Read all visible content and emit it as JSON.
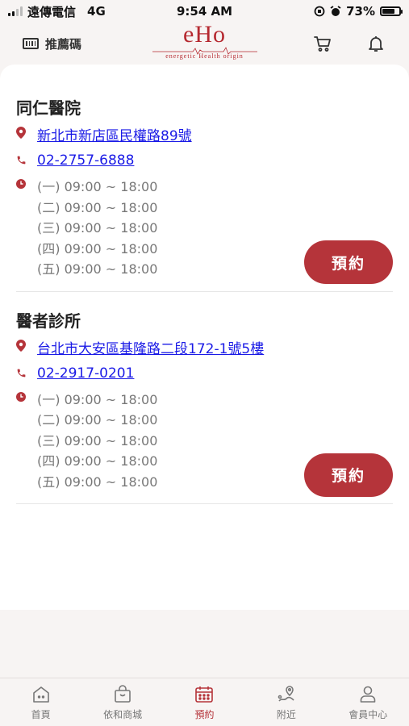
{
  "status_bar": {
    "carrier": "遠傳電信",
    "network": "4G",
    "time": "9:54 AM",
    "battery_text": "73%",
    "battery_level": 0.73
  },
  "header": {
    "referral_label": "推薦碼",
    "logo_text": "eHo",
    "logo_tagline": "energetic Health origin",
    "brand_color": "#b5282f"
  },
  "clinics": [
    {
      "name": "同仁醫院",
      "address": "新北市新店區民權路89號",
      "phone": "02-2757-6888",
      "hours": [
        "(一) 09:00 ~ 18:00",
        "(二) 09:00 ~ 18:00",
        "(三) 09:00 ~ 18:00",
        "(四) 09:00 ~ 18:00",
        "(五) 09:00 ~ 18:00"
      ],
      "book_label": "預約"
    },
    {
      "name": "醫者診所",
      "address": "台北市大安區基隆路二段172-1號5樓",
      "phone": "02-2917-0201",
      "hours": [
        "(一) 09:00 ~ 18:00",
        "(二) 09:00 ~ 18:00",
        "(三) 09:00 ~ 18:00",
        "(四) 09:00 ~ 18:00",
        "(五) 09:00 ~ 18:00"
      ],
      "book_label": "預約"
    }
  ],
  "tab_bar": {
    "tabs": [
      {
        "label": "首頁",
        "icon": "home-icon",
        "active": false
      },
      {
        "label": "依和商城",
        "icon": "shopping-bag-icon",
        "active": false
      },
      {
        "label": "預約",
        "icon": "calendar-icon",
        "active": true
      },
      {
        "label": "附近",
        "icon": "location-icon",
        "active": false
      },
      {
        "label": "會員中心",
        "icon": "user-icon",
        "active": false
      }
    ],
    "active_color": "#b5343a",
    "inactive_color": "#777777"
  }
}
